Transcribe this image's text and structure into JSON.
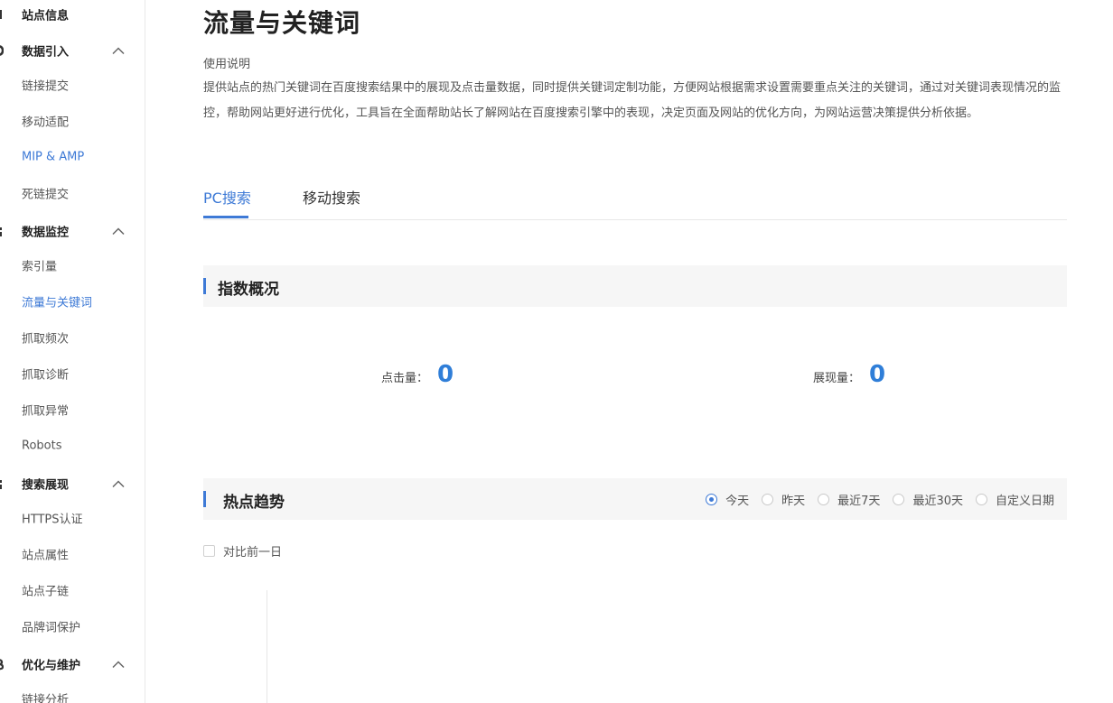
{
  "sidebar": {
    "items": [
      {
        "label": "站点信息",
        "type": "group",
        "expanded": null
      },
      {
        "label": "数据引入",
        "type": "group",
        "expanded": true
      },
      {
        "label": "链接提交",
        "type": "item"
      },
      {
        "label": "移动适配",
        "type": "item"
      },
      {
        "label": "MIP & AMP",
        "type": "item",
        "highlight": true
      },
      {
        "label": "死链提交",
        "type": "item"
      },
      {
        "label": "数据监控",
        "type": "group",
        "expanded": true
      },
      {
        "label": "索引量",
        "type": "item"
      },
      {
        "label": "流量与关键词",
        "type": "item",
        "active": true
      },
      {
        "label": "抓取频次",
        "type": "item"
      },
      {
        "label": "抓取诊断",
        "type": "item"
      },
      {
        "label": "抓取异常",
        "type": "item"
      },
      {
        "label": "Robots",
        "type": "item"
      },
      {
        "label": "搜索展现",
        "type": "group",
        "expanded": true
      },
      {
        "label": "HTTPS认证",
        "type": "item"
      },
      {
        "label": "站点属性",
        "type": "item"
      },
      {
        "label": "站点子链",
        "type": "item"
      },
      {
        "label": "品牌词保护",
        "type": "item"
      },
      {
        "label": "优化与维护",
        "type": "group",
        "expanded": true
      },
      {
        "label": "链接分析",
        "type": "item"
      }
    ]
  },
  "main": {
    "title": "流量与关键词",
    "usage_title": "使用说明",
    "usage_text": "提供站点的热门关键词在百度搜索结果中的展现及点击量数据，同时提供关键词定制功能，方便网站根据需求设置需要重点关注的关键词，通过对关键词表现情况的监控，帮助网站更好进行优化，工具旨在全面帮助站长了解网站在百度搜索引擎中的表现，决定页面及网站的优化方向，为网站运营决策提供分析依据。",
    "tabs": [
      {
        "label": "PC搜索",
        "active": true
      },
      {
        "label": "移动搜索",
        "active": false
      }
    ],
    "overview": {
      "title": "指数概况",
      "clicks_label": "点击量：",
      "clicks_value": "0",
      "impressions_label": "展现量：",
      "impressions_value": "0"
    },
    "trend": {
      "title": "热点趋势",
      "ranges": [
        {
          "label": "今天",
          "checked": true
        },
        {
          "label": "昨天",
          "checked": false
        },
        {
          "label": "最近7天",
          "checked": false
        },
        {
          "label": "最近30天",
          "checked": false
        },
        {
          "label": "自定义日期",
          "checked": false
        }
      ],
      "compare_label": "对比前一日",
      "compare_checked": false
    }
  },
  "colors": {
    "accent": "#3e7ad6",
    "metric_value": "#2f7ed8",
    "section_bg": "#f6f6f6"
  }
}
